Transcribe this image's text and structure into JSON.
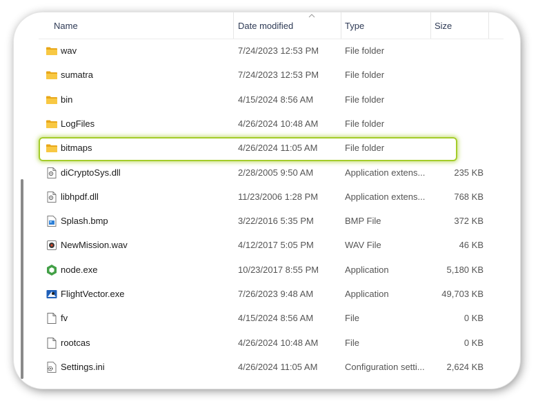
{
  "columns": {
    "name": "Name",
    "date_modified": "Date modified",
    "type": "Type",
    "size": "Size"
  },
  "sort": {
    "column": "date_modified",
    "direction": "ascending"
  },
  "highlight_color": "#a4cc2a",
  "rows": [
    {
      "name": "wav",
      "date": "7/24/2023 12:53 PM",
      "type": "File folder",
      "size": "",
      "icon": "folder-icon"
    },
    {
      "name": "sumatra",
      "date": "7/24/2023 12:53 PM",
      "type": "File folder",
      "size": "",
      "icon": "folder-icon"
    },
    {
      "name": "bin",
      "date": "4/15/2024 8:56 AM",
      "type": "File folder",
      "size": "",
      "icon": "folder-icon"
    },
    {
      "name": "LogFiles",
      "date": "4/26/2024 10:48 AM",
      "type": "File folder",
      "size": "",
      "icon": "folder-icon"
    },
    {
      "name": "bitmaps",
      "date": "4/26/2024 11:05 AM",
      "type": "File folder",
      "size": "",
      "icon": "folder-icon",
      "highlighted": true
    },
    {
      "name": "diCryptoSys.dll",
      "date": "2/28/2005 9:50 AM",
      "type": "Application extens...",
      "size": "235 KB",
      "icon": "dll-icon"
    },
    {
      "name": "libhpdf.dll",
      "date": "11/23/2006 1:28 PM",
      "type": "Application extens...",
      "size": "768 KB",
      "icon": "dll-icon"
    },
    {
      "name": "Splash.bmp",
      "date": "3/22/2016 5:35 PM",
      "type": "BMP File",
      "size": "372 KB",
      "icon": "bmp-icon"
    },
    {
      "name": "NewMission.wav",
      "date": "4/12/2017 5:05 PM",
      "type": "WAV File",
      "size": "46 KB",
      "icon": "wav-icon"
    },
    {
      "name": "node.exe",
      "date": "10/23/2017 8:55 PM",
      "type": "Application",
      "size": "5,180 KB",
      "icon": "nodejs-icon"
    },
    {
      "name": "FlightVector.exe",
      "date": "7/26/2023 9:48 AM",
      "type": "Application",
      "size": "49,703 KB",
      "icon": "app-icon"
    },
    {
      "name": "fv",
      "date": "4/15/2024 8:56 AM",
      "type": "File",
      "size": "0 KB",
      "icon": "file-icon"
    },
    {
      "name": "rootcas",
      "date": "4/26/2024 10:48 AM",
      "type": "File",
      "size": "0 KB",
      "icon": "file-icon"
    },
    {
      "name": "Settings.ini",
      "date": "4/26/2024 11:05 AM",
      "type": "Configuration setti...",
      "size": "2,624 KB",
      "icon": "ini-icon"
    }
  ]
}
